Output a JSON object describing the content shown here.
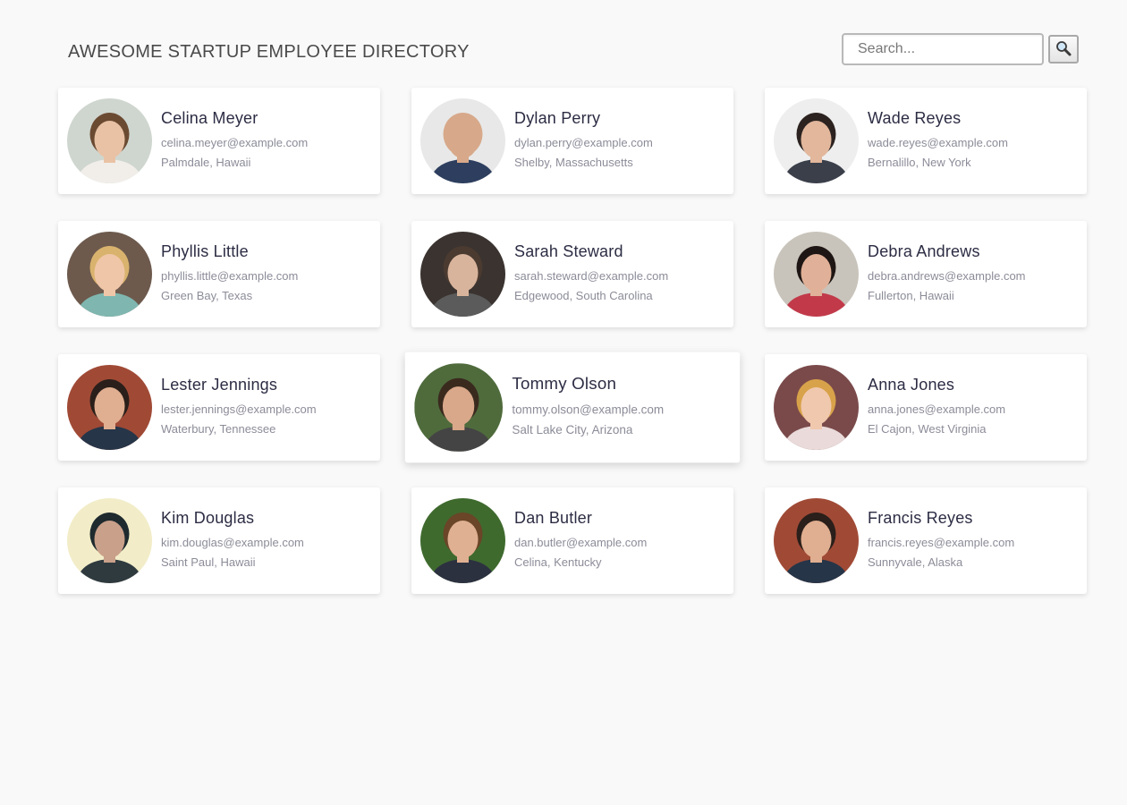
{
  "header": {
    "title": "AWESOME STARTUP EMPLOYEE DIRECTORY",
    "search_placeholder": "Search...",
    "search_button_icon": "magnifier-icon"
  },
  "employees": [
    {
      "name": "Celina Meyer",
      "email": "celina.meyer@example.com",
      "location": "Palmdale, Hawaii",
      "avatar": {
        "bg": "#cfd6cf",
        "skin": "#e9c2a5",
        "hair": "#6b4a32",
        "shirt": "#f1eeea"
      }
    },
    {
      "name": "Dylan Perry",
      "email": "dylan.perry@example.com",
      "location": "Shelby, Massachusetts",
      "avatar": {
        "bg": "#e8e8e8",
        "skin": "#d7a98a",
        "hair": "#d7a98a",
        "shirt": "#2d3e5e"
      }
    },
    {
      "name": "Wade Reyes",
      "email": "wade.reyes@example.com",
      "location": "Bernalillo, New York",
      "avatar": {
        "bg": "#eeeeee",
        "skin": "#e2b79c",
        "hair": "#2c2320",
        "shirt": "#3a3f4a"
      }
    },
    {
      "name": "Phyllis Little",
      "email": "phyllis.little@example.com",
      "location": "Green Bay, Texas",
      "avatar": {
        "bg": "#6d5a4d",
        "skin": "#f0c6a8",
        "hair": "#d9b36e",
        "shirt": "#7fb7b0"
      }
    },
    {
      "name": "Sarah Steward",
      "email": "sarah.steward@example.com",
      "location": "Edgewood, South Carolina",
      "avatar": {
        "bg": "#3a3330",
        "skin": "#d9b49c",
        "hair": "#4a3a30",
        "shirt": "#5b5b5b"
      }
    },
    {
      "name": "Debra Andrews",
      "email": "debra.andrews@example.com",
      "location": "Fullerton, Hawaii",
      "avatar": {
        "bg": "#c9c4bb",
        "skin": "#e0b198",
        "hair": "#1e1614",
        "shirt": "#c23a4a"
      }
    },
    {
      "name": "Lester Jennings",
      "email": "lester.jennings@example.com",
      "location": "Waterbury, Tennessee",
      "avatar": {
        "bg": "#a04a36",
        "skin": "#e0ae90",
        "hair": "#2a1f1a",
        "shirt": "#263548"
      }
    },
    {
      "name": "Tommy Olson",
      "email": "tommy.olson@example.com",
      "location": "Salt Lake City, Arizona",
      "avatar": {
        "bg": "#4f6b3c",
        "skin": "#d9a88a",
        "hair": "#3a2a1e",
        "shirt": "#444444"
      }
    },
    {
      "name": "Anna Jones",
      "email": "anna.jones@example.com",
      "location": "El Cajon, West Virginia",
      "avatar": {
        "bg": "#7a4a4a",
        "skin": "#f0c8ae",
        "hair": "#d8a24a",
        "shirt": "#eadada"
      }
    },
    {
      "name": "Kim Douglas",
      "email": "kim.douglas@example.com",
      "location": "Saint Paul, Hawaii",
      "avatar": {
        "bg": "#f2edc8",
        "skin": "#c9a08a",
        "hair": "#1e2a2e",
        "shirt": "#2f3a3f"
      }
    },
    {
      "name": "Dan Butler",
      "email": "dan.butler@example.com",
      "location": "Celina, Kentucky",
      "avatar": {
        "bg": "#3f6a2e",
        "skin": "#e0b092",
        "hair": "#6a4528",
        "shirt": "#2c3140"
      }
    },
    {
      "name": "Francis Reyes",
      "email": "francis.reyes@example.com",
      "location": "Sunnyvale, Alaska",
      "avatar": {
        "bg": "#a04a36",
        "skin": "#e0ae90",
        "hair": "#2a1f1a",
        "shirt": "#263548"
      }
    }
  ]
}
